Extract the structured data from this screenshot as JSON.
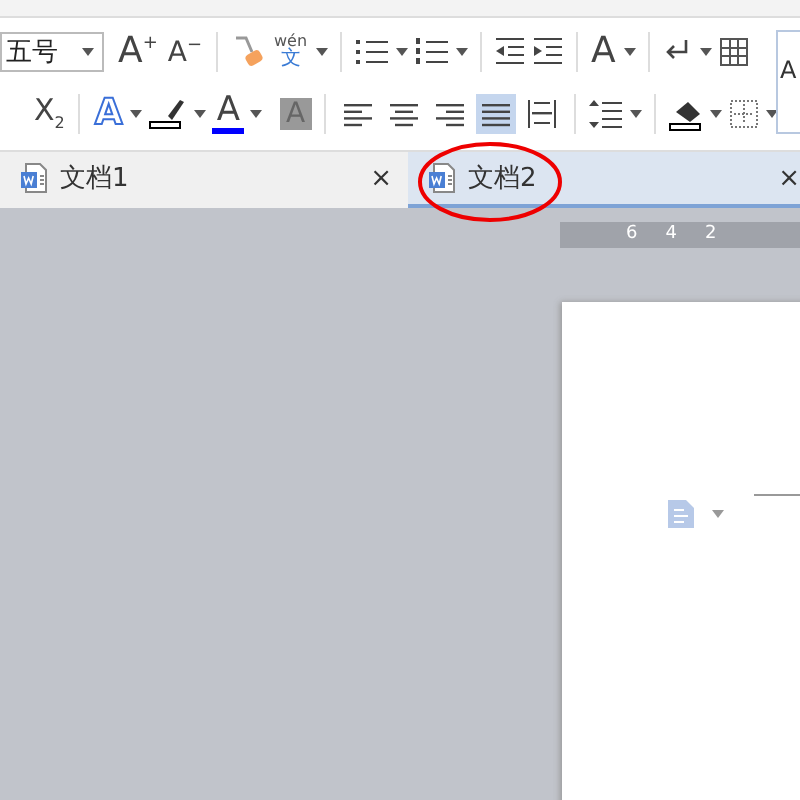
{
  "ribbon": {
    "font_size": "五号",
    "grow_font": {
      "letter": "A",
      "mark": "+"
    },
    "shrink_font": {
      "letter": "A",
      "mark": "−"
    },
    "phonetic": {
      "top": "wén",
      "bottom": "文"
    },
    "subscript": {
      "letter": "X",
      "mark": "2"
    },
    "text_effect": "A",
    "font_color": "A",
    "char_shading": "A",
    "change_case": "A",
    "style_preview": "A",
    "alignment": [
      {
        "kind": "left",
        "selected": false
      },
      {
        "kind": "center",
        "selected": false
      },
      {
        "kind": "right",
        "selected": false
      },
      {
        "kind": "justify",
        "selected": true
      },
      {
        "kind": "distributed",
        "selected": false
      }
    ]
  },
  "tabs": [
    {
      "label": "文档1",
      "selected": false,
      "close": "×"
    },
    {
      "label": "文档2",
      "selected": true,
      "close": "×"
    }
  ],
  "ruler": {
    "numbers": [
      "6",
      "4",
      "2"
    ]
  }
}
